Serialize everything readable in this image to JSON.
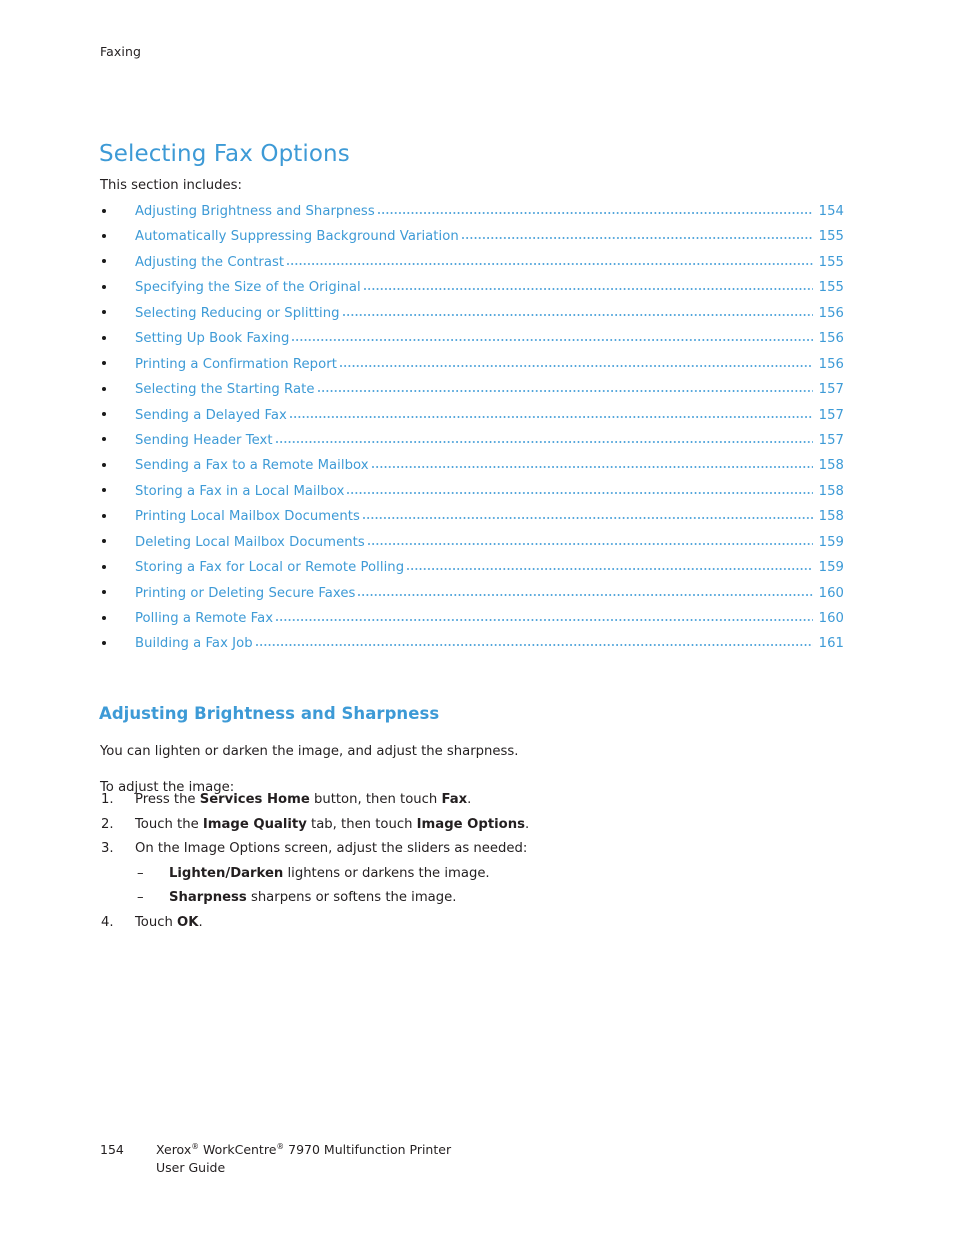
{
  "header": {
    "running_head": "Faxing"
  },
  "title": "Selecting Fax Options",
  "intro": "This section includes:",
  "toc": {
    "entries": [
      {
        "label": "Adjusting Brightness and Sharpness",
        "page": "154"
      },
      {
        "label": "Automatically Suppressing Background Variation",
        "page": "155"
      },
      {
        "label": "Adjusting the Contrast",
        "page": "155"
      },
      {
        "label": "Specifying the Size of the Original",
        "page": "155"
      },
      {
        "label": "Selecting Reducing or Splitting",
        "page": "156"
      },
      {
        "label": "Setting Up Book Faxing",
        "page": "156"
      },
      {
        "label": "Printing a Confirmation Report",
        "page": "156"
      },
      {
        "label": "Selecting the Starting Rate",
        "page": "157"
      },
      {
        "label": "Sending a Delayed Fax",
        "page": "157"
      },
      {
        "label": "Sending Header Text",
        "page": "157"
      },
      {
        "label": "Sending a Fax to a Remote Mailbox",
        "page": "158"
      },
      {
        "label": "Storing a Fax in a Local Mailbox",
        "page": "158"
      },
      {
        "label": "Printing Local Mailbox Documents",
        "page": "158"
      },
      {
        "label": "Deleting Local Mailbox Documents",
        "page": "159"
      },
      {
        "label": "Storing a Fax for Local or Remote Polling",
        "page": "159"
      },
      {
        "label": "Printing or Deleting Secure Faxes",
        "page": "160"
      },
      {
        "label": "Polling a Remote Fax",
        "page": "160"
      },
      {
        "label": "Building a Fax Job",
        "page": "161"
      }
    ]
  },
  "section": {
    "heading": "Adjusting Brightness and Sharpness",
    "paragraph_1": "You can lighten or darken the image, and adjust the sharpness.",
    "paragraph_2": "To adjust the image:",
    "steps": [
      {
        "number": "1.",
        "html": "Press the <b>Services Home</b> button, then touch <b>Fax</b>."
      },
      {
        "number": "2.",
        "html": "Touch the <b>Image Quality</b> tab, then touch <b>Image Options</b>."
      },
      {
        "number": "3.",
        "html": "On the Image Options screen, adjust the sliders as needed:"
      }
    ],
    "substeps": [
      {
        "dash": "–",
        "html": "<b>Lighten/Darken</b> lightens or darkens the image."
      },
      {
        "dash": "–",
        "html": "<b>Sharpness</b> sharpens or softens the image."
      }
    ],
    "final_step": {
      "number": "4.",
      "html": "Touch <b>OK</b>."
    }
  },
  "footer": {
    "page_number": "154",
    "line1_html": "Xerox<sup>®</sup> WorkCentre<sup>®</sup> 7970 Multifunction Printer",
    "line2": "User Guide"
  },
  "colors": {
    "accent_blue": "#3d9ad6",
    "body_text": "#231f20",
    "bullet": "#1a1a1a"
  }
}
